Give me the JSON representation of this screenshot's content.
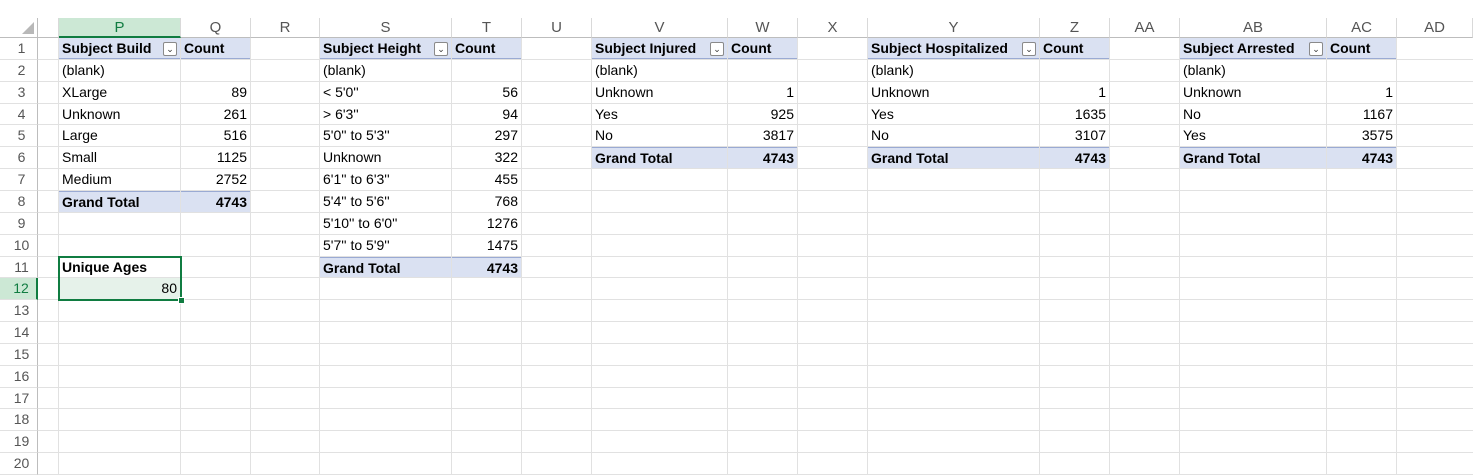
{
  "columns": [
    "P",
    "Q",
    "R",
    "S",
    "T",
    "U",
    "V",
    "W",
    "X",
    "Y",
    "Z",
    "AA",
    "AB",
    "AC",
    "AD"
  ],
  "rows": [
    "1",
    "2",
    "3",
    "4",
    "5",
    "6",
    "7",
    "8",
    "9",
    "10",
    "11",
    "12",
    "13",
    "14",
    "15",
    "16",
    "17",
    "18",
    "19",
    "20"
  ],
  "selected_column": "P",
  "selected_row": "12",
  "pivots": {
    "build": {
      "field": "Subject Build",
      "count": "Count",
      "rows": [
        [
          "(blank)",
          ""
        ],
        [
          "XLarge",
          "89"
        ],
        [
          "Unknown",
          "261"
        ],
        [
          "Large",
          "516"
        ],
        [
          "Small",
          "1125"
        ],
        [
          "Medium",
          "2752"
        ]
      ],
      "total": [
        "Grand Total",
        "4743"
      ]
    },
    "height": {
      "field": "Subject Height",
      "count": "Count",
      "rows": [
        [
          "(blank)",
          ""
        ],
        [
          "< 5'0''",
          "56"
        ],
        [
          "> 6'3''",
          "94"
        ],
        [
          "5'0'' to 5'3''",
          "297"
        ],
        [
          "Unknown",
          "322"
        ],
        [
          "6'1'' to 6'3''",
          "455"
        ],
        [
          "5'4'' to 5'6''",
          "768"
        ],
        [
          "5'10'' to 6'0''",
          "1276"
        ],
        [
          "5'7'' to 5'9''",
          "1475"
        ]
      ],
      "total": [
        "Grand Total",
        "4743"
      ]
    },
    "injured": {
      "field": "Subject Injured",
      "count": "Count",
      "rows": [
        [
          "(blank)",
          ""
        ],
        [
          "Unknown",
          "1"
        ],
        [
          "Yes",
          "925"
        ],
        [
          "No",
          "3817"
        ]
      ],
      "total": [
        "Grand Total",
        "4743"
      ]
    },
    "hospitalized": {
      "field": "Subject Hospitalized",
      "count": "Count",
      "rows": [
        [
          "(blank)",
          ""
        ],
        [
          "Unknown",
          "1"
        ],
        [
          "Yes",
          "1635"
        ],
        [
          "No",
          "3107"
        ]
      ],
      "total": [
        "Grand Total",
        "4743"
      ]
    },
    "arrested": {
      "field": "Subject Arrested",
      "count": "Count",
      "rows": [
        [
          "(blank)",
          ""
        ],
        [
          "Unknown",
          "1"
        ],
        [
          "No",
          "1167"
        ],
        [
          "Yes",
          "3575"
        ]
      ],
      "total": [
        "Grand Total",
        "4743"
      ]
    }
  },
  "unique_ages": {
    "label": "Unique Ages",
    "value": "80"
  },
  "icons": {
    "dropdown": "filter-dropdown-icon",
    "corner": "select-all-icon"
  },
  "colors": {
    "pivot_header": "#dae1f2",
    "selection": "#107c41",
    "selected_header": "#cce8d5"
  }
}
